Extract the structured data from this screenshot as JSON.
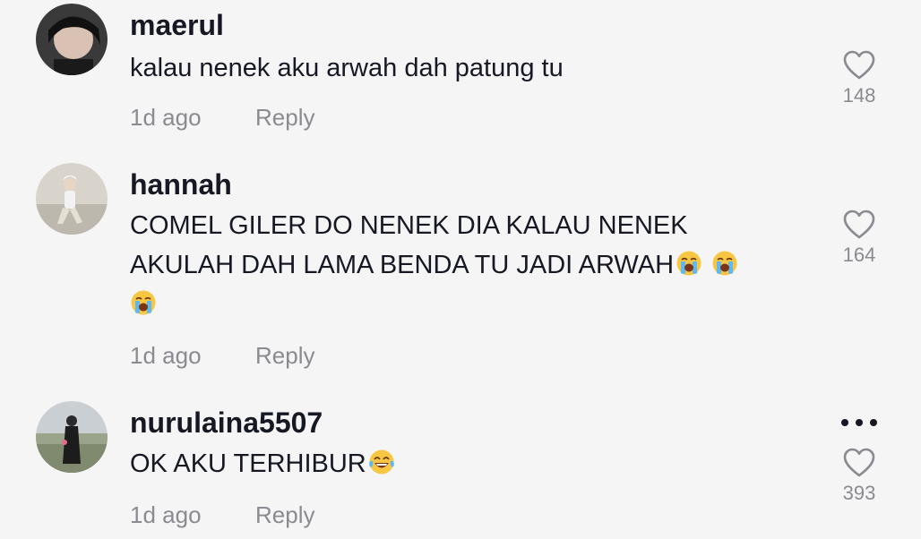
{
  "comments": [
    {
      "username": "maerul",
      "text": "kalau nenek aku arwah dah patung tu",
      "time": "1d ago",
      "reply_label": "Reply",
      "likes": "148"
    },
    {
      "username": "hannah",
      "text_line1": "COMEL GILER DO NENEK DIA KALAU NENEK",
      "text_line2": "AKULAH DAH LAMA BENDA TU JADI ARWAH",
      "time": "1d ago",
      "reply_label": "Reply",
      "likes": "164"
    },
    {
      "username": "nurulaina5507",
      "text": "OK AKU TERHIBUR",
      "time": "1d ago",
      "reply_label": "Reply",
      "likes": "393"
    }
  ],
  "colors": {
    "background": "#f5f5f5",
    "primary_text": "#161823",
    "secondary_text": "#8a8b91"
  }
}
